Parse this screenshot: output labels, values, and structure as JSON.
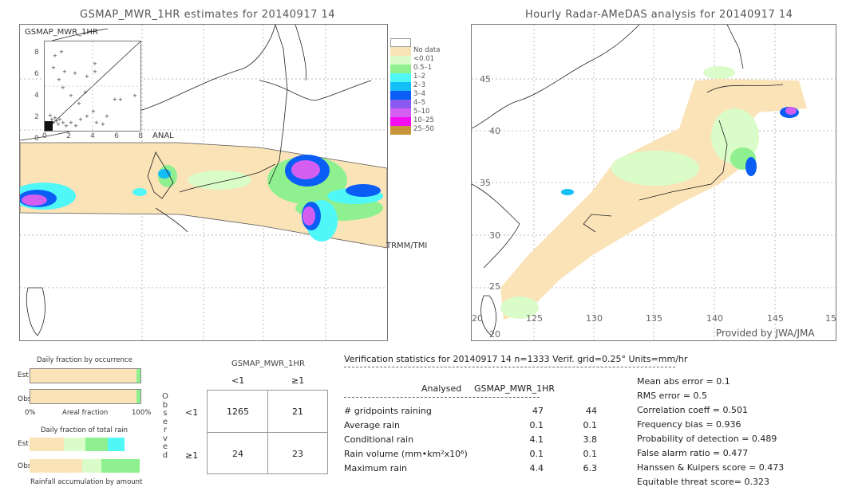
{
  "left_panel": {
    "title": "GSMAP_MWR_1HR estimates for 20140917 14",
    "scatter": {
      "label": "GSMAP_MWR_1HR",
      "x_label": "ANAL",
      "y_ticks": [
        "8",
        "6",
        "4",
        "2",
        "0"
      ],
      "x_ticks": [
        "0",
        "2",
        "4",
        "6",
        "8"
      ]
    },
    "sensor_label": "TRMM/TMI"
  },
  "legend": {
    "items": [
      {
        "label": "No data",
        "color": "#fbe3b8"
      },
      {
        "label": "<0.01",
        "color": "#d9fcc8"
      },
      {
        "label": "0.5–1",
        "color": "#8ff08f"
      },
      {
        "label": "1–2",
        "color": "#50f7f7"
      },
      {
        "label": "2–3",
        "color": "#14bef7"
      },
      {
        "label": "3–4",
        "color": "#0a5ef5"
      },
      {
        "label": "4–5",
        "color": "#8a5af0"
      },
      {
        "label": "5–10",
        "color": "#d35ef0"
      },
      {
        "label": "10–25",
        "color": "#f20ef0"
      },
      {
        "label": "25–50",
        "color": "#c8943a"
      }
    ],
    "top_swatch_color": "#ffffff"
  },
  "right_panel": {
    "title": "Hourly Radar-AMeDAS analysis for 20140917 14",
    "lat_labels": [
      "45",
      "40",
      "35",
      "30",
      "25",
      "20"
    ],
    "lon_labels": [
      "20",
      "125",
      "130",
      "135",
      "140",
      "145",
      "15"
    ],
    "credit": "Provided by JWA/JMA"
  },
  "occurrence": {
    "title": "Daily fraction by occurrence",
    "est_label": "Est",
    "obs_label": "Obs",
    "axis_left": "0%",
    "axis_mid": "Areal fraction",
    "axis_right": "100%",
    "est_fractions": [
      0.967,
      0.033
    ],
    "obs_fractions": [
      0.965,
      0.035
    ]
  },
  "total_rain": {
    "title": "Daily fraction of total rain",
    "est_label": "Est",
    "obs_label": "Obs",
    "footer": "Rainfall accumulation by amount",
    "est_segments": [
      {
        "fraction": 0.31,
        "color": "#fbe3b8"
      },
      {
        "fraction": 0.2,
        "color": "#d9fcc8"
      },
      {
        "fraction": 0.2,
        "color": "#8ff08f"
      },
      {
        "fraction": 0.15,
        "color": "#50f7f7"
      }
    ],
    "obs_segments": [
      {
        "fraction": 0.48,
        "color": "#fbe3b8"
      },
      {
        "fraction": 0.17,
        "color": "#d9fcc8"
      },
      {
        "fraction": 0.35,
        "color": "#8ff08f"
      }
    ]
  },
  "contingency": {
    "header": "GSMAP_MWR_1HR",
    "col_labels": [
      "<1",
      "≥1"
    ],
    "row_labels": [
      "<1",
      "≥1"
    ],
    "side_label": [
      "O",
      "b",
      "s",
      "e",
      "r",
      "v",
      "e",
      "d"
    ],
    "cells": [
      [
        "1265",
        "21"
      ],
      [
        "24",
        "23"
      ]
    ]
  },
  "verification": {
    "header": "Verification statistics for 20140917 14   n=1333   Verif. grid=0.25°   Units=mm/hr",
    "col_analysed": "Analysed",
    "col_gsmap": "GSMAP_MWR_1HR",
    "rows": [
      {
        "label": "# gridpoints raining",
        "analysed": "47",
        "gsmap": "44"
      },
      {
        "label": "Average rain",
        "analysed": "0.1",
        "gsmap": "0.1"
      },
      {
        "label": "Conditional rain",
        "analysed": "4.1",
        "gsmap": "3.8"
      },
      {
        "label": "Rain volume (mm•km²x10⁶)",
        "analysed": "0.1",
        "gsmap": "0.1"
      },
      {
        "label": "Maximum rain",
        "analysed": "4.4",
        "gsmap": "6.3"
      }
    ],
    "scores": [
      "Mean abs error = 0.1",
      "RMS error = 0.5",
      "Correlation coeff = 0.501",
      "Frequency bias = 0.936",
      "Probability of detection = 0.489",
      "False alarm ratio = 0.477",
      "Hanssen & Kuipers score = 0.473",
      "Equitable threat score= 0.323"
    ]
  }
}
